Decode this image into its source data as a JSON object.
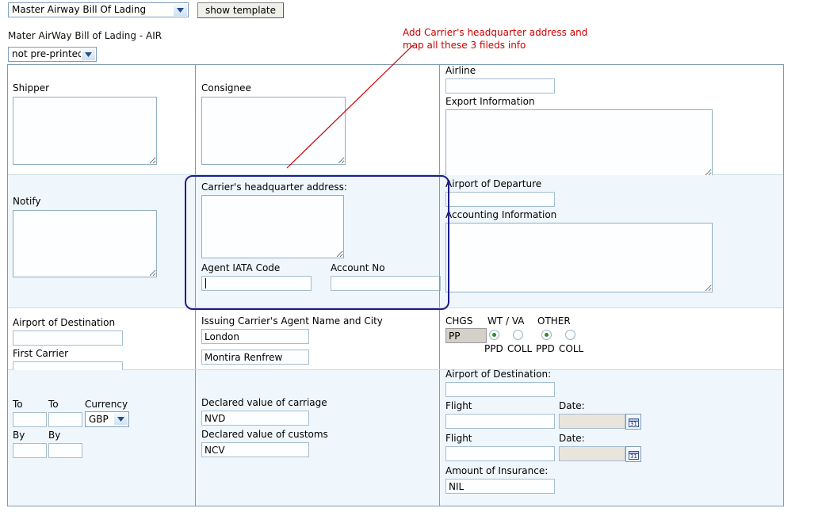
{
  "toolbar": {
    "template_select_value": "Master Airway Bill Of Lading",
    "show_template_label": "show template",
    "dropdown_icon": "chevron-down-icon"
  },
  "document": {
    "title": "Mater AirWay Bill of Lading - AIR",
    "preprint_select_value": "not pre-printed"
  },
  "annotation": {
    "line1": "Add Carrier's headquarter address and",
    "line2": "map all these 3 fileds info",
    "color": "#cc0000",
    "highlight_color": "#1d1d8c"
  },
  "form": {
    "shipper": {
      "label": "Shipper",
      "value": ""
    },
    "consignee": {
      "label": "Consignee",
      "value": ""
    },
    "airline": {
      "label": "Airline",
      "value": ""
    },
    "export_information": {
      "label": "Export Information",
      "value": ""
    },
    "notify": {
      "label": "Notify",
      "value": ""
    },
    "carrier_hq_address": {
      "label": "Carrier's headquarter address:",
      "value": ""
    },
    "agent_iata_code": {
      "label": "Agent IATA Code",
      "value": ""
    },
    "account_no": {
      "label": "Account No",
      "value": ""
    },
    "airport_of_departure": {
      "label": "Airport of Departure",
      "value": ""
    },
    "accounting_information": {
      "label": "Accounting Information",
      "value": ""
    },
    "airport_of_destination_left": {
      "label": "Airport of Destination",
      "value": ""
    },
    "first_carrier": {
      "label": "First Carrier",
      "value": ""
    },
    "issuing_carrier_agent": {
      "label": "Issuing Carrier's Agent Name and City",
      "city_value": "London",
      "name_value": "Montira Renfrew"
    },
    "charges": {
      "chgs_label": "CHGS",
      "chgs_value": "PP",
      "wt_va_label": "WT / VA",
      "other_label": "OTHER",
      "wt_va_ppd_label": "PPD",
      "wt_va_coll_label": "COLL",
      "other_ppd_label": "PPD",
      "other_coll_label": "COLL",
      "wt_va_selected": "PPD",
      "other_selected": "PPD"
    },
    "to1": {
      "label": "To",
      "value": ""
    },
    "to2": {
      "label": "To",
      "value": ""
    },
    "currency": {
      "label": "Currency",
      "value": "GBP"
    },
    "by1": {
      "label": "By",
      "value": ""
    },
    "by2": {
      "label": "By",
      "value": ""
    },
    "declared_value_carriage": {
      "label": "Declared value of carriage",
      "value": "NVD"
    },
    "declared_value_customs": {
      "label": "Declared value of customs",
      "value": "NCV"
    },
    "airport_of_destination_right": {
      "label": "Airport of Destination:",
      "value": ""
    },
    "flight1": {
      "label": "Flight",
      "value": ""
    },
    "date1": {
      "label": "Date:",
      "value": "",
      "icon": "calendar-icon",
      "icon_day": "31"
    },
    "flight2": {
      "label": "Flight",
      "value": ""
    },
    "date2": {
      "label": "Date:",
      "value": "",
      "icon": "calendar-icon",
      "icon_day": "31"
    },
    "amount_of_insurance": {
      "label": "Amount of Insurance:",
      "value": "NIL"
    }
  }
}
